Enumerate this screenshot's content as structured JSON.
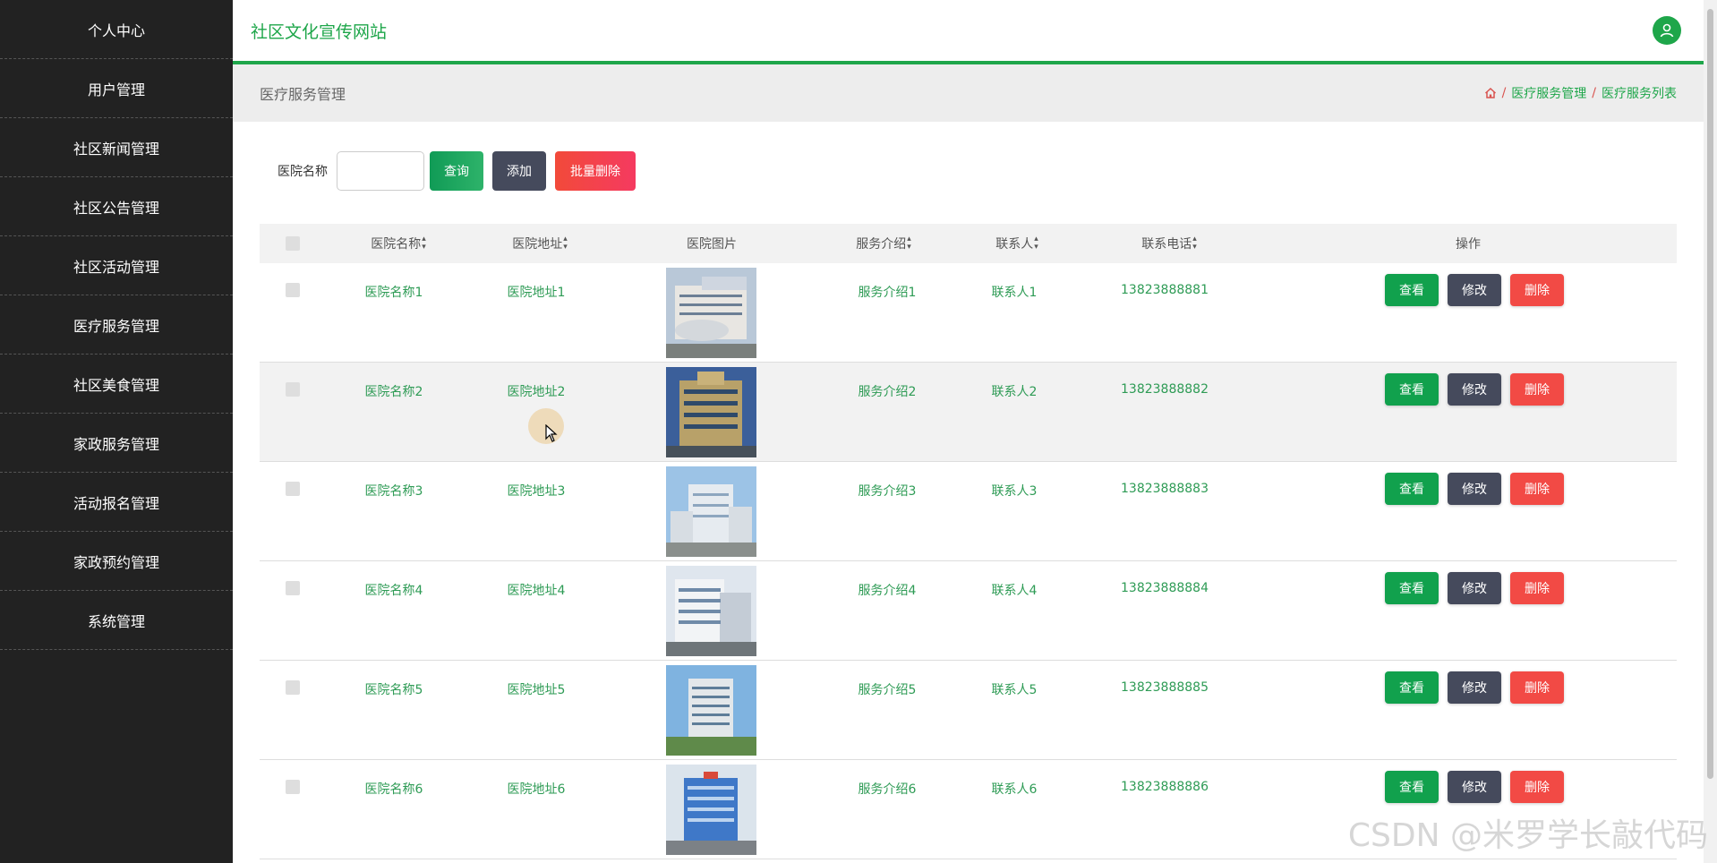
{
  "sidebar": {
    "items": [
      {
        "label": "个人中心"
      },
      {
        "label": "用户管理"
      },
      {
        "label": "社区新闻管理"
      },
      {
        "label": "社区公告管理"
      },
      {
        "label": "社区活动管理"
      },
      {
        "label": "医疗服务管理"
      },
      {
        "label": "社区美食管理"
      },
      {
        "label": "家政服务管理"
      },
      {
        "label": "活动报名管理"
      },
      {
        "label": "家政预约管理"
      },
      {
        "label": "系统管理"
      }
    ]
  },
  "header": {
    "site_title": "社区文化宣传网站",
    "avatar_icon": "user-icon"
  },
  "subheader": {
    "title": "医疗服务管理",
    "breadcrumb": [
      "医疗服务管理",
      "医疗服务列表"
    ]
  },
  "search": {
    "label": "医院名称",
    "value": "",
    "query_label": "查询",
    "add_label": "添加",
    "batch_delete_label": "批量删除"
  },
  "table": {
    "headers": [
      "医院名称",
      "医院地址",
      "医院图片",
      "服务介绍",
      "联系人",
      "联系电话",
      "操作"
    ],
    "rows": [
      {
        "name": "医院名称1",
        "address": "医院地址1",
        "intro": "服务介绍1",
        "contact": "联系人1",
        "phone": "13823888881"
      },
      {
        "name": "医院名称2",
        "address": "医院地址2",
        "intro": "服务介绍2",
        "contact": "联系人2",
        "phone": "13823888882"
      },
      {
        "name": "医院名称3",
        "address": "医院地址3",
        "intro": "服务介绍3",
        "contact": "联系人3",
        "phone": "13823888883"
      },
      {
        "name": "医院名称4",
        "address": "医院地址4",
        "intro": "服务介绍4",
        "contact": "联系人4",
        "phone": "13823888884"
      },
      {
        "name": "医院名称5",
        "address": "医院地址5",
        "intro": "服务介绍5",
        "contact": "联系人5",
        "phone": "13823888885"
      },
      {
        "name": "医院名称6",
        "address": "医院地址6",
        "intro": "服务介绍6",
        "contact": "联系人6",
        "phone": "13823888886"
      }
    ],
    "actions": {
      "view": "查看",
      "edit": "修改",
      "delete": "删除"
    }
  },
  "watermark": "CSDN @米罗学长敲代码",
  "colors": {
    "accent": "#1ea64a",
    "sidebar": "#222222",
    "danger": "#f24a45",
    "dark_button": "#454a5c"
  }
}
